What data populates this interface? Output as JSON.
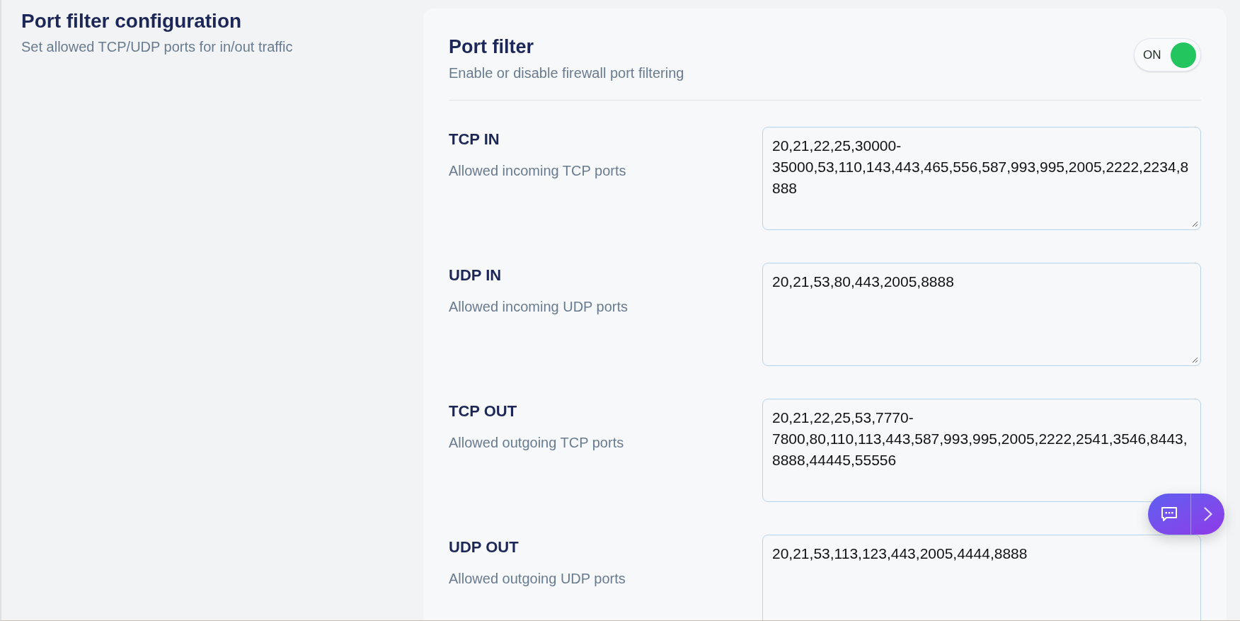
{
  "section": {
    "title": "Port filter configuration",
    "subtitle": "Set allowed TCP/UDP ports for in/out traffic"
  },
  "port_filter": {
    "title": "Port filter",
    "subtitle": "Enable or disable firewall port filtering",
    "toggle": {
      "label": "ON",
      "on": true
    }
  },
  "rules": [
    {
      "label": "TCP IN",
      "description": "Allowed incoming TCP ports",
      "value": "20,21,22,25,30000-35000,53,110,143,443,465,556,587,993,995,2005,2222,2234,8888"
    },
    {
      "label": "UDP IN",
      "description": "Allowed incoming UDP ports",
      "value": "20,21,53,80,443,2005,8888"
    },
    {
      "label": "TCP OUT",
      "description": "Allowed outgoing TCP ports",
      "value": "20,21,22,25,53,7770-7800,80,110,113,443,587,993,995,2005,2222,2541,3546,8443,8888,44445,55556"
    },
    {
      "label": "UDP OUT",
      "description": "Allowed outgoing UDP ports",
      "value": "20,21,53,113,123,443,2005,4444,8888"
    }
  ]
}
